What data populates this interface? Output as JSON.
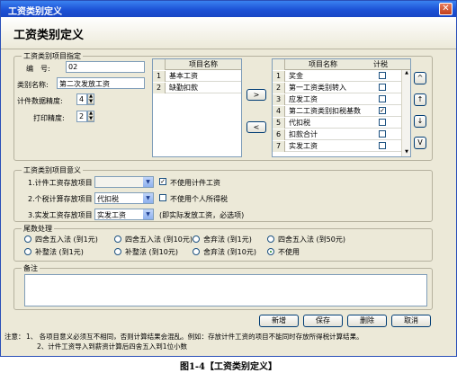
{
  "window": {
    "title": "工资类别定义",
    "close_glyph": "✕"
  },
  "header": {
    "title": "工资类别定义"
  },
  "spec_group": {
    "legend": "工资类别项目指定",
    "code_label": "编　号:",
    "code_value": "02",
    "name_label": "类别名称:",
    "name_value": "第二次发放工资",
    "calc_precision_label": "计件数据精度:",
    "calc_precision_value": "4",
    "print_precision_label": "打印精度:",
    "print_precision_value": "2"
  },
  "left_grid": {
    "header": "项目名称",
    "rows": [
      {
        "num": "1",
        "name": "基本工资"
      },
      {
        "num": "2",
        "name": "缺勤扣款"
      }
    ]
  },
  "move_buttons": {
    "right": ">",
    "left": "<"
  },
  "right_grid": {
    "header_name": "项目名称",
    "header_tax": "计税",
    "rows": [
      {
        "num": "1",
        "name": "奖金",
        "tax": false
      },
      {
        "num": "2",
        "name": "第一工资类别转入",
        "tax": false
      },
      {
        "num": "3",
        "name": "应发工资",
        "tax": false
      },
      {
        "num": "4",
        "name": "第二工资类别扣税基数",
        "tax": true
      },
      {
        "num": "5",
        "name": "代扣税",
        "tax": false
      },
      {
        "num": "6",
        "name": "扣款合计",
        "tax": false
      },
      {
        "num": "7",
        "name": "实发工资",
        "tax": false
      }
    ],
    "check_glyph": "✓"
  },
  "order_buttons": {
    "top": "^",
    "up": "↑",
    "down": "↓",
    "bottom": "V"
  },
  "meaning_group": {
    "legend": "工资类别项目意义",
    "row1_label": "1.计件工资存放项目",
    "row1_value": "",
    "row1_check_label": "不使用计件工资",
    "row2_label": "2.个税计算存放项目",
    "row2_value": "代扣税",
    "row2_check_label": "不使用个人所得税",
    "row3_label": "3.实发工资存放项目",
    "row3_value": "实发工资",
    "row3_note": "(即实际发放工资，必选项)"
  },
  "rounding_group": {
    "legend": "尾数处理",
    "options": [
      "四舍五入法 (到1元)",
      "四舍五入法 (到10元)",
      "舍弃法 (到1元)",
      "四舍五入法 (到50元)",
      "补整法 (到1元)",
      "补整法 (到10元)",
      "舍弃法 (到10元)",
      "不使用"
    ],
    "selected": "不使用"
  },
  "remarks_group": {
    "legend": "备注",
    "value": ""
  },
  "footer_buttons": {
    "add": "新增",
    "save": "保存",
    "delete": "删除",
    "cancel": "取消"
  },
  "notes": {
    "prefix": "注意：",
    "line1": "1、 各项目意义必须互不相同，否则计算结果会混乱。例如：存放计件工资的项目不能同时存放所得税计算结果。",
    "line2": "2、计件工资导入到薪资计算后四舍五入到1位小数"
  },
  "figure_caption": "图1-4【工资类别定义】"
}
